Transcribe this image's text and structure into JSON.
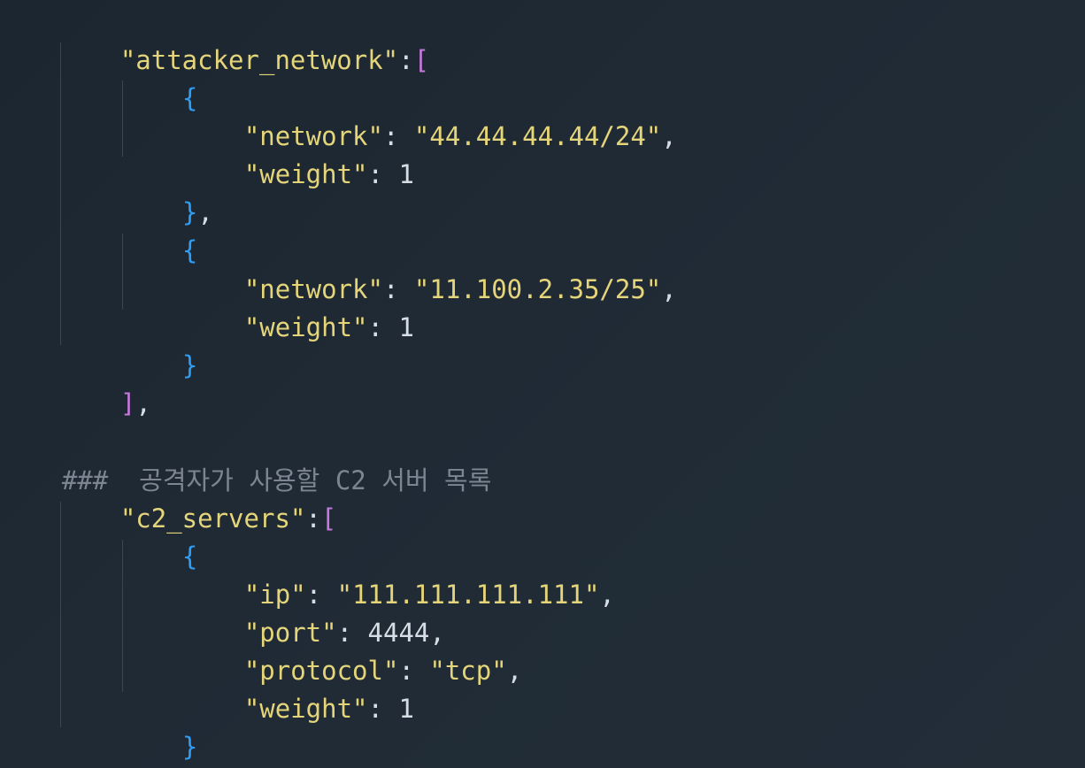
{
  "colors": {
    "background": "#1f2a35",
    "string": "#e5d57a",
    "punctuation": "#d6dde4",
    "bracket": "#c678dd",
    "brace": "#2f9df4",
    "comment": "#7c8591",
    "indent_guide": "#3a4652"
  },
  "code": {
    "l1": {
      "key": "\"attacker_network\"",
      "punc": ":",
      "bracket": "["
    },
    "l2": {
      "brace": "{"
    },
    "l3": {
      "key": "\"network\"",
      "punc": ": ",
      "value": "\"44.44.44.44/24\"",
      "tail": ","
    },
    "l4": {
      "key": "\"weight\"",
      "punc": ": ",
      "value": "1"
    },
    "l5": {
      "brace": "}",
      "tail": ","
    },
    "l6": {
      "brace": "{"
    },
    "l7": {
      "key": "\"network\"",
      "punc": ": ",
      "value": "\"11.100.2.35/25\"",
      "tail": ","
    },
    "l8": {
      "key": "\"weight\"",
      "punc": ": ",
      "value": "1"
    },
    "l9": {
      "brace": "}"
    },
    "l10": {
      "bracket": "]",
      "tail": ","
    },
    "l12": {
      "comment": "###  공격자가 사용할 C2 서버 목록"
    },
    "l13": {
      "key": "\"c2_servers\"",
      "punc": ":",
      "bracket": "["
    },
    "l14": {
      "brace": "{"
    },
    "l15": {
      "key": "\"ip\"",
      "punc": ": ",
      "value": "\"111.111.111.111\"",
      "tail": ","
    },
    "l16": {
      "key": "\"port\"",
      "punc": ": ",
      "value": "4444",
      "tail": ","
    },
    "l17": {
      "key": "\"protocol\"",
      "punc": ": ",
      "value": "\"tcp\"",
      "tail": ","
    },
    "l18": {
      "key": "\"weight\"",
      "punc": ": ",
      "value": "1"
    },
    "l19": {
      "brace": "}"
    },
    "l20": {
      "bracket": "]",
      "tail": ","
    }
  }
}
